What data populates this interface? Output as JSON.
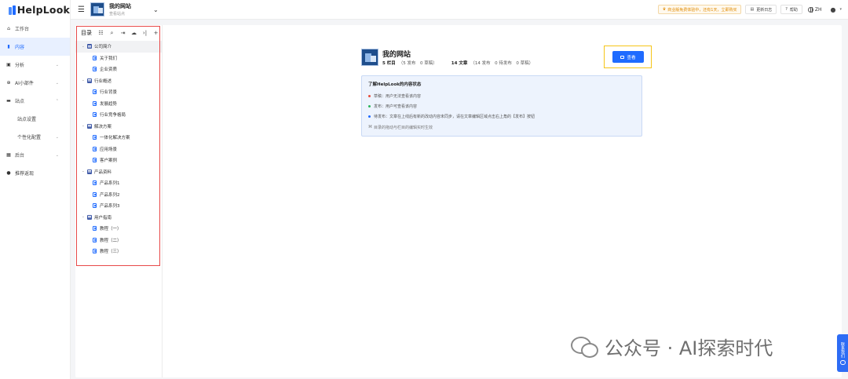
{
  "app": {
    "brand": "HelpLook"
  },
  "leftnav": {
    "items": [
      {
        "label": "工作台",
        "icon": "home-icon",
        "glyph": "⌂",
        "chevron": ""
      },
      {
        "label": "内容",
        "icon": "content-icon",
        "glyph": "▮",
        "chevron": "",
        "active": true
      },
      {
        "label": "分析",
        "icon": "analytics-icon",
        "glyph": "▣",
        "chevron": "⌄"
      },
      {
        "label": "AI小部件",
        "icon": "ai-widget-icon",
        "glyph": "⊕",
        "chevron": "⌄"
      },
      {
        "label": "站点",
        "icon": "site-icon",
        "glyph": "▬",
        "chevron": "⌃"
      }
    ],
    "site_sub": [
      "站点设置",
      "个性化配置"
    ],
    "site_sub_chevron": "⌄",
    "bottom": [
      {
        "label": "后台",
        "icon": "backend-icon",
        "glyph": "▦",
        "chevron": "⌄"
      },
      {
        "label": "推荐返现",
        "icon": "referral-icon",
        "glyph": "●",
        "chevron": ""
      }
    ]
  },
  "topbar": {
    "site_name": "我的网站",
    "site_sub": "查看站点",
    "trial": "商业版免费体验中，还有1天，立即购买",
    "changelog": "更新日志",
    "help": "帮助",
    "lang": "ZH"
  },
  "tree": {
    "label": "目录",
    "folders": [
      {
        "name": "公司简介",
        "docs": [
          "关于我们",
          "企业资质"
        ]
      },
      {
        "name": "行业概述",
        "docs": [
          "行业背景",
          "发展趋势",
          "行业竞争格局"
        ]
      },
      {
        "name": "解决方案",
        "docs": [
          "一体化解决方案",
          "应用场景",
          "客户案例"
        ]
      },
      {
        "name": "产品资料",
        "docs": [
          "产品系列1",
          "产品系列2",
          "产品系列3"
        ]
      },
      {
        "name": "用户指南",
        "docs": [
          "教程（一）",
          "教程（二）",
          "教程（三）"
        ]
      }
    ]
  },
  "main": {
    "title": "我的网站",
    "columns": "5 栏目",
    "columns_detail": "（5 发布　0 草稿）",
    "articles": "14 文章",
    "articles_detail": "（14 发布　0 待发布　0 草稿）",
    "view_button": "查看",
    "info": {
      "title": "了解HelpLook的内容状态",
      "lines": [
        {
          "text": "草稿：用户无法查看该内容",
          "color": "#e64c3c"
        },
        {
          "text": "发布：用户可查看该内容",
          "color": "#2db55d"
        },
        {
          "text": "待发布：文章在上线后有新的改动内容未同步，请在文章编辑区域点击右上角的【发布】按钮",
          "color": "#1f6bff"
        }
      ],
      "note": "目录的拖动与栏目的编辑实时生效"
    }
  },
  "watermark": "公众号 · AI探索时代",
  "side_float": "联系我们"
}
